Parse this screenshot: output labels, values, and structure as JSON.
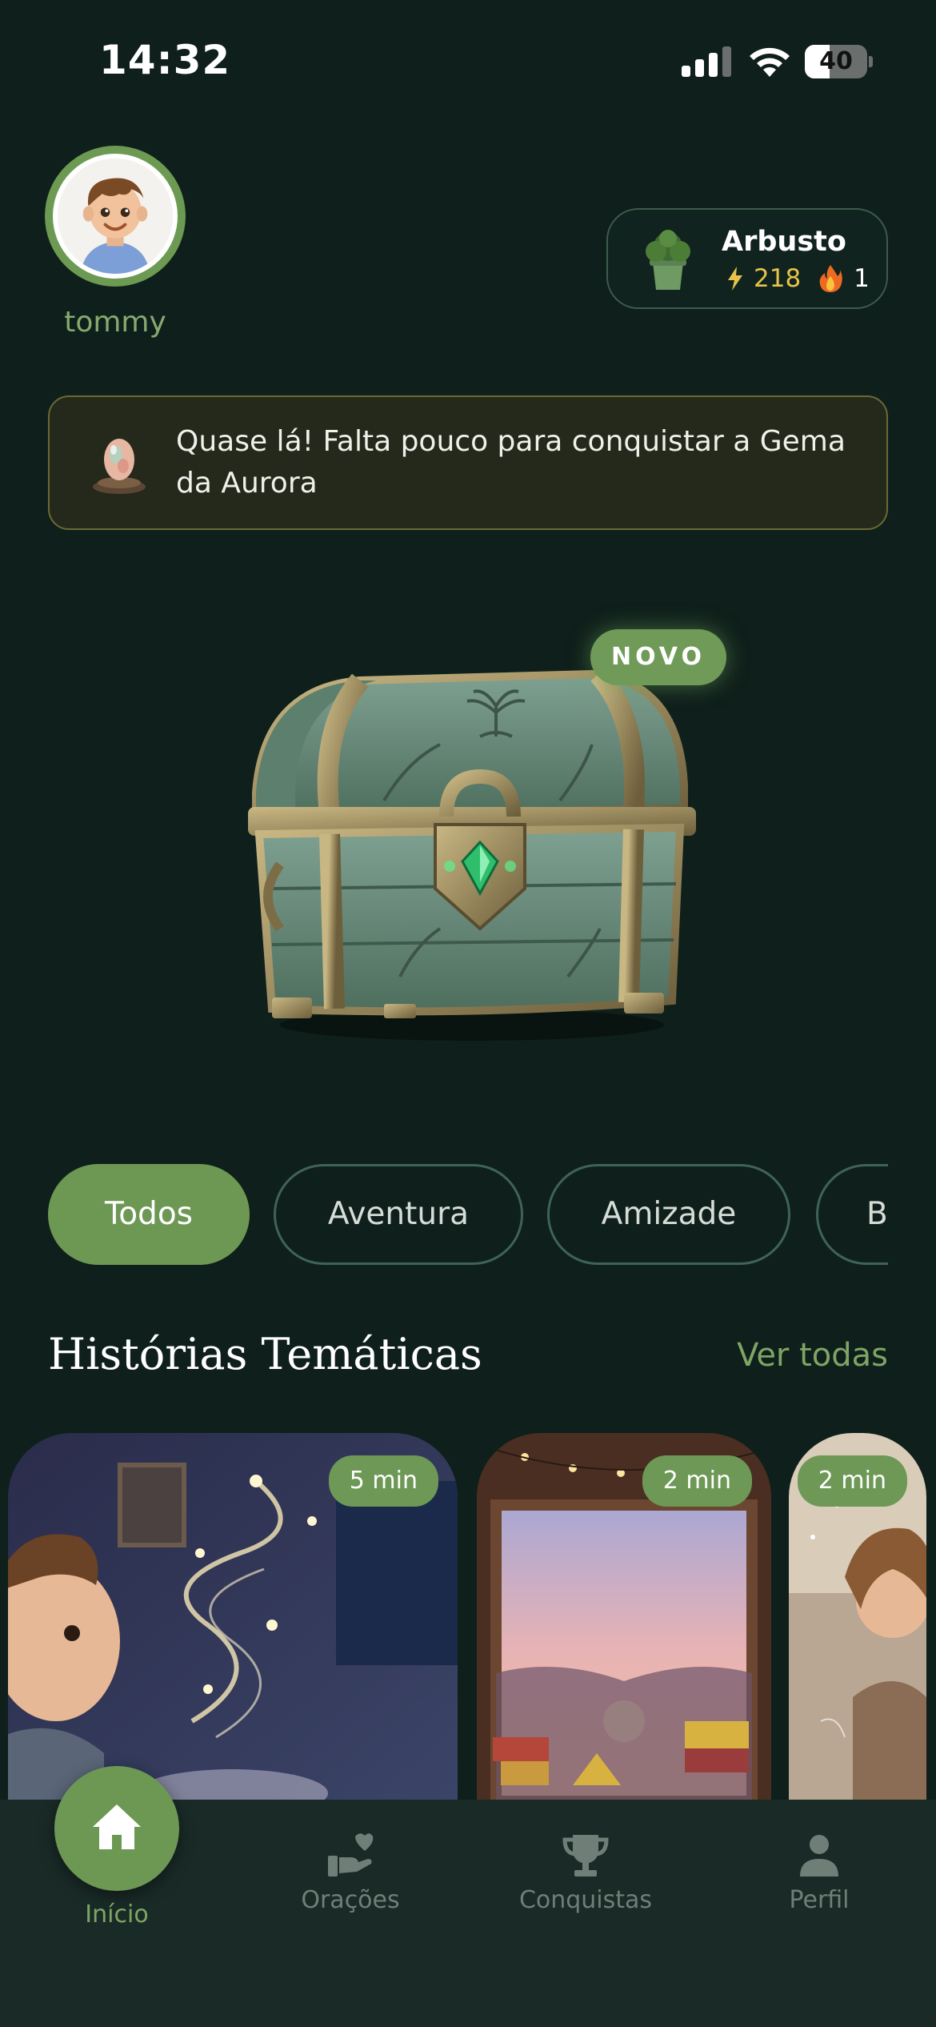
{
  "status_bar": {
    "time": "14:32",
    "battery_percent": "40",
    "battery_level": 0.4
  },
  "profile": {
    "username": "tommy",
    "avatar_icon": "boy-avatar-icon"
  },
  "level": {
    "name": "Arbusto",
    "xp": "218",
    "streak": "1",
    "plant_icon": "potted-bush-icon",
    "xp_icon": "bolt-icon",
    "streak_icon": "fire-icon"
  },
  "banner": {
    "text": "Quase lá! Falta pouco para conquistar a Gema da Aurora",
    "icon": "gem-on-pedestal-icon"
  },
  "chest": {
    "badge": "NOVO",
    "icon": "treasure-chest-icon"
  },
  "filters": {
    "items": [
      "Todos",
      "Aventura",
      "Amizade",
      "B"
    ],
    "selected": "Todos"
  },
  "section": {
    "title": "Histórias Temáticas",
    "see_all": "Ver todas"
  },
  "stories": [
    {
      "duration": "5 min"
    },
    {
      "duration": "2 min"
    },
    {
      "duration": "2 min"
    }
  ],
  "nav": {
    "home": "Início",
    "prayers": "Orações",
    "achievements": "Conquistas",
    "profile": "Perfil"
  },
  "colors": {
    "background": "#0f1f1b",
    "accent": "#6d9854",
    "xp": "#e7c34b",
    "nav": "#1a2b27"
  }
}
